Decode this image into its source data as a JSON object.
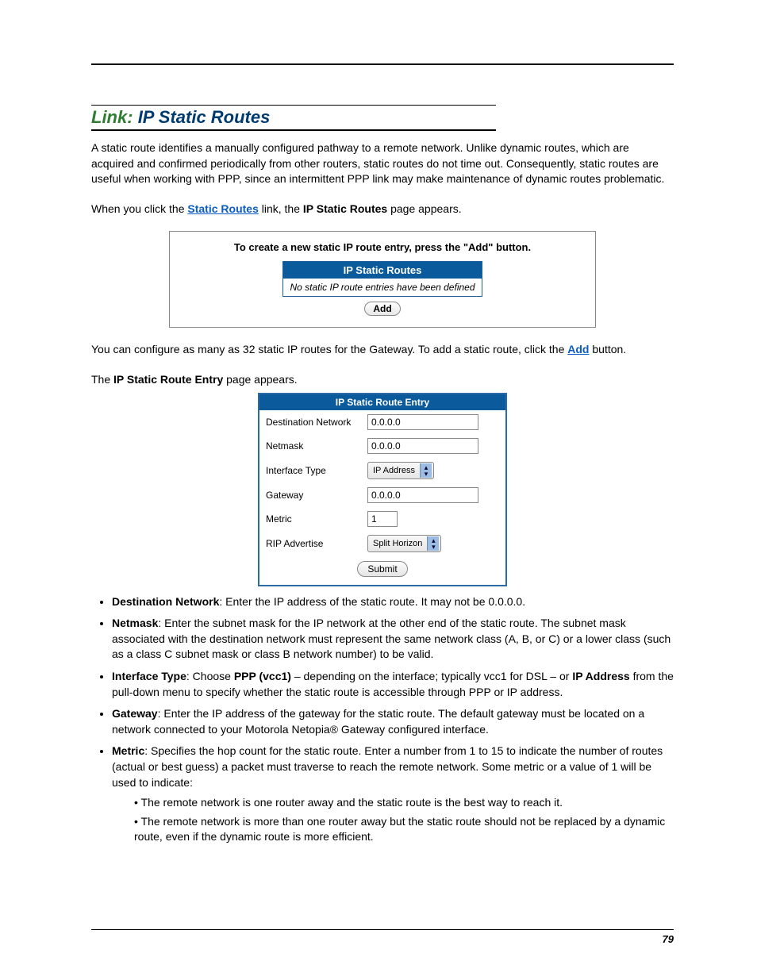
{
  "heading": {
    "prefix": "Link:",
    "title": "IP Static Routes"
  },
  "para1": "A static route identifies a manually configured pathway to a remote network. Unlike dynamic routes, which are acquired and confirmed periodically from other routers, static routes do not time out. Consequently, static routes are useful when working with PPP, since an intermittent PPP link may make maintenance of dynamic routes problematic.",
  "para2_pre": "When you click the ",
  "para2_link": "Static Routes",
  "para2_mid": " link, the ",
  "para2_bold": "IP Static Routes",
  "para2_post": " page appears.",
  "shot1": {
    "instruction": "To create a new static IP route entry, press the \"Add\" button.",
    "header": "IP Static Routes",
    "body": "No static IP route entries have been defined",
    "add": "Add"
  },
  "para3_pre": "You can configure as many as 32 static IP routes for the Gateway. To add a static route, click the ",
  "para3_link": "Add",
  "para3_post": " button.",
  "para4_pre": "The ",
  "para4_bold": "IP Static Route Entry",
  "para4_post": " page appears.",
  "shot2": {
    "header": "IP Static Route Entry",
    "rows": {
      "dest_label": "Destination Network",
      "dest_val": "0.0.0.0",
      "netmask_label": "Netmask",
      "netmask_val": "0.0.0.0",
      "iface_label": "Interface Type",
      "iface_val": "IP Address",
      "gw_label": "Gateway",
      "gw_val": "0.0.0.0",
      "metric_label": "Metric",
      "metric_val": "1",
      "rip_label": "RIP Advertise",
      "rip_val": "Split Horizon"
    },
    "submit": "Submit"
  },
  "defs": {
    "dest": {
      "term": "Destination Network",
      "text": ": Enter the IP address of the static route. It may not be 0.0.0.0."
    },
    "netmask": {
      "term": "Netmask",
      "text": ": Enter the subnet mask for the IP network at the other end of the static route. The subnet mask associated with the destination network must represent the same network class (A, B, or C) or a lower class (such as a class C subnet mask or class B network number) to be valid."
    },
    "iface": {
      "term": "Interface Type",
      "pre": ": Choose ",
      "b1": "PPP (vcc1)",
      "mid": " – depending on the interface; typically vcc1 for DSL – or ",
      "b2": "IP Address",
      "post": " from the pull-down menu to specify whether the static route is accessible through PPP or IP address."
    },
    "gw": {
      "term": "Gateway",
      "text": ": Enter the IP address of the gateway for the static route. The default gateway must be located on a network connected to your Motorola Netopia® Gateway configured interface."
    },
    "metric": {
      "term": "Metric",
      "text": ": Specifies the hop count for the static route. Enter a number from 1 to 15 to indicate the number of routes (actual or best guess) a packet must traverse to reach the remote network. Some metric or a value of 1 will be used to indicate:",
      "sub1": "The remote network is one router away and the static route is the best way to reach it.",
      "sub2": "The remote network is more than one router away but the static route should not be replaced by a dynamic route, even if the dynamic route is more efficient."
    }
  },
  "page_number": "79"
}
